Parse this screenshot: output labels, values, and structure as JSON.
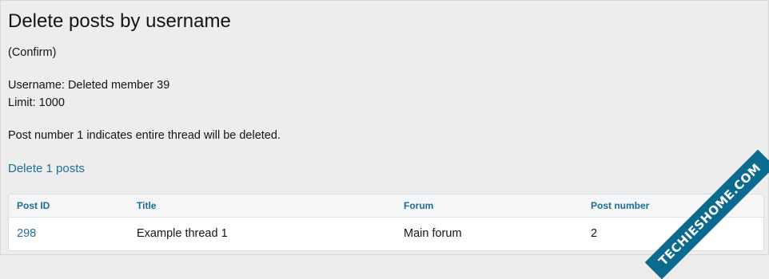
{
  "title": "Delete posts by username",
  "confirm_text": "(Confirm)",
  "username_line": "Username: Deleted member 39",
  "limit_line": "Limit: 1000",
  "note": "Post number 1 indicates entire thread will be deleted.",
  "delete_link": "Delete 1 posts",
  "table": {
    "headers": [
      "Post ID",
      "Title",
      "Forum",
      "Post number"
    ],
    "rows": [
      [
        "298",
        "Example thread 1",
        "Main forum",
        "2"
      ]
    ]
  },
  "watermark": "TECHIESHOME.COM",
  "colors": {
    "link": "#1c6f95",
    "watermark_bg": "#0b6b8e"
  }
}
